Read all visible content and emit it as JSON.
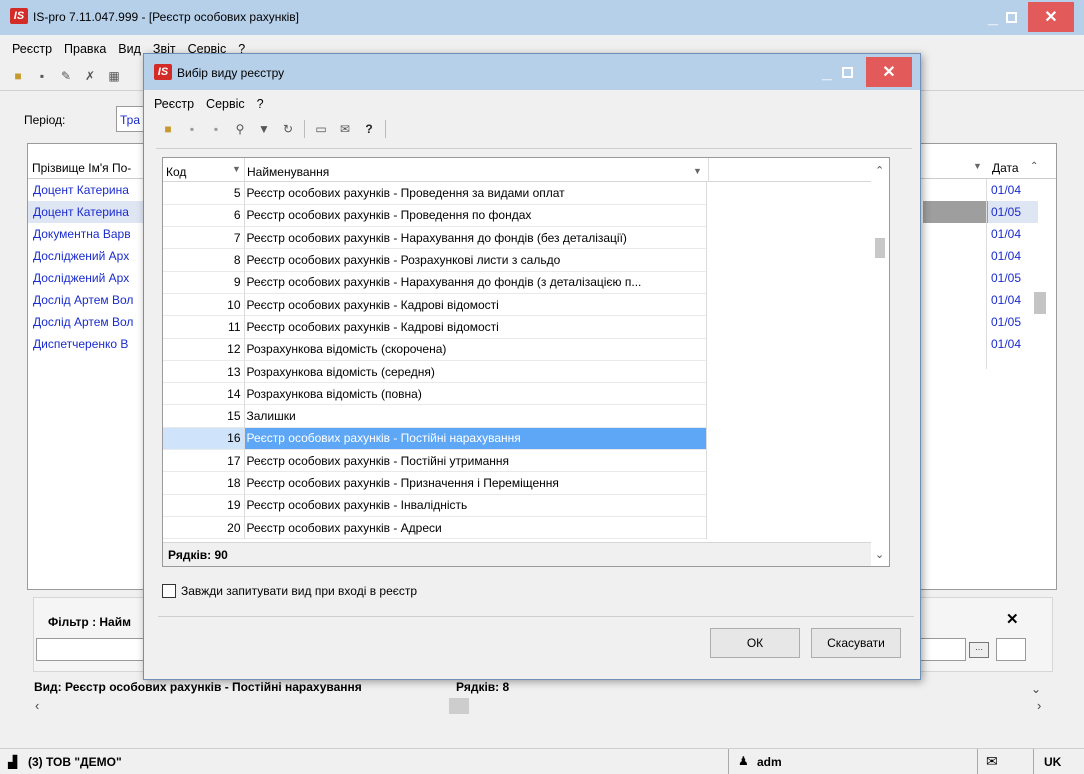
{
  "main_window": {
    "title": "IS-pro 7.11.047.999 - [Реєстр особових рахунків]",
    "logo": "IS",
    "menu": [
      "Реєстр",
      "Правка",
      "Вид",
      "Звіт",
      "Сервіс",
      "?"
    ],
    "period_label": "Період:",
    "period_value": "Тра",
    "list_header_name": "Прізвище Ім'я По-",
    "list_header_date": "Дата",
    "rows": [
      {
        "name": "Доцент Катерина",
        "date": "01/04"
      },
      {
        "name": "Доцент Катерина",
        "date": "01/05"
      },
      {
        "name": "Документна Варв",
        "date": "01/04"
      },
      {
        "name": "Досліджений Арх",
        "date": "01/04"
      },
      {
        "name": "Досліджений Арх",
        "date": "01/05"
      },
      {
        "name": "Дослід Артем Вол",
        "date": "01/04"
      },
      {
        "name": "Дослід Артем Вол",
        "date": "01/05"
      },
      {
        "name": "Диспетчеренко В",
        "date": "01/04"
      }
    ],
    "filter_label": "Фільтр : Найм",
    "filter_close": "✕",
    "status_vid": "Вид: Реєстр особових рахунків - Постійні нарахування",
    "status_rows": "Рядків: 8"
  },
  "statusbar": {
    "company": "(3) ТОВ \"ДЕМО\"",
    "user": "adm",
    "lang": "UK"
  },
  "dialog": {
    "title": "Вибір виду реєстру",
    "logo": "IS",
    "menu": [
      "Реєстр",
      "Сервіс",
      "?"
    ],
    "col_code": "Код",
    "col_name": "Найменування",
    "rows": [
      {
        "code": "5",
        "name": "Реєстр особових рахунків - Проведення за видами оплат"
      },
      {
        "code": "6",
        "name": "Реєстр особових рахунків - Проведення по фондах"
      },
      {
        "code": "7",
        "name": "Реєстр особових рахунків - Нарахування до фондів (без деталізації)"
      },
      {
        "code": "8",
        "name": "Реєстр особових рахунків - Розрахункові листи з сальдо"
      },
      {
        "code": "9",
        "name": "Реєстр особових рахунків - Нарахування до фондів (з деталізацією п..."
      },
      {
        "code": "10",
        "name": "Реєстр особових рахунків - Кадрові відомості"
      },
      {
        "code": "11",
        "name": "Реєстр особових рахунків - Кадрові відомості"
      },
      {
        "code": "12",
        "name": "Розрахункова відомість (скорочена)"
      },
      {
        "code": "13",
        "name": "Розрахункова відомість (середня)"
      },
      {
        "code": "14",
        "name": "Розрахункова відомість (повна)"
      },
      {
        "code": "15",
        "name": "Залишки"
      },
      {
        "code": "16",
        "name": "Реєстр особових рахунків - Постійні нарахування",
        "selected": true
      },
      {
        "code": "17",
        "name": "Реєстр особових рахунків - Постійні утримання"
      },
      {
        "code": "18",
        "name": "Реєстр особових рахунків - Призначення і Переміщення"
      },
      {
        "code": "19",
        "name": "Реєстр особових рахунків - Інвалідність"
      },
      {
        "code": "20",
        "name": "Реєстр особових рахунків - Адреси"
      }
    ],
    "row_count": "Рядків: 90",
    "checkbox_label": "Завжди запитувати вид при вході в реєстр",
    "ok_label": "ОК",
    "cancel_label": "Скасувати"
  },
  "colors": {
    "titlebar": "#b7d0ea",
    "close": "#e35a5a",
    "selection": "#5ea7f7",
    "link": "#1a2bcf"
  }
}
